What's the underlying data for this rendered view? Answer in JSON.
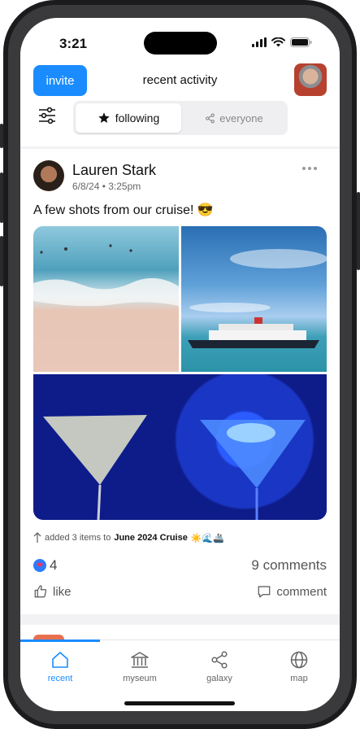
{
  "status_bar": {
    "time": "3:21"
  },
  "header": {
    "invite_label": "invite",
    "title": "recent activity",
    "segments": {
      "following": "following",
      "everyone": "everyone",
      "selected": "following"
    }
  },
  "post": {
    "author": "Lauren Stark",
    "meta": "6/8/24 • 3:25pm",
    "caption": "A few shots from our cruise! 😎",
    "activity_prefix": "added 3 items to",
    "collection": "June 2024 Cruise",
    "collection_emoji": "☀️🌊🚢",
    "like_count": "4",
    "comments_count": "9 comments",
    "like_label": "like",
    "comment_label": "comment"
  },
  "tabs": [
    {
      "label": "recent",
      "icon": "home-icon",
      "active": true
    },
    {
      "label": "myseum",
      "icon": "museum-icon",
      "active": false
    },
    {
      "label": "galaxy",
      "icon": "share-network-icon",
      "active": false
    },
    {
      "label": "map",
      "icon": "globe-icon",
      "active": false
    }
  ],
  "colors": {
    "accent": "#1a8cff",
    "heart": "#ff3355"
  }
}
